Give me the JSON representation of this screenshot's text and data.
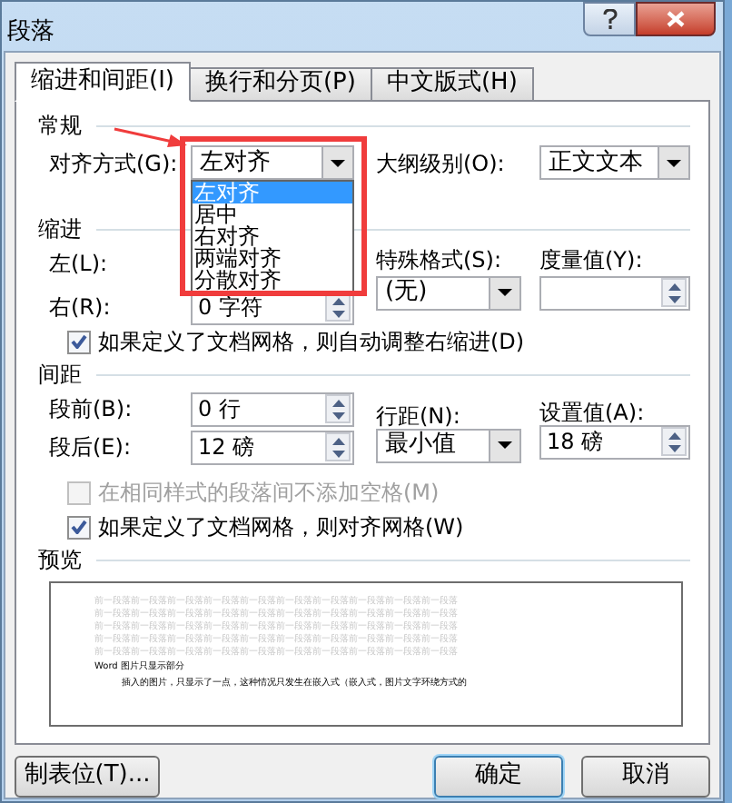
{
  "window": {
    "title": "段落"
  },
  "tabs": [
    {
      "label": "缩进和间距(I)",
      "selected": true
    },
    {
      "label": "换行和分页(P)",
      "selected": false
    },
    {
      "label": "中文版式(H)",
      "selected": false
    }
  ],
  "general": {
    "heading": "常规",
    "alignment": {
      "label": "对齐方式(G):",
      "value": "左对齐",
      "options": [
        {
          "label": "左对齐",
          "selected": true
        },
        {
          "label": "居中",
          "selected": false
        },
        {
          "label": "右对齐",
          "selected": false
        },
        {
          "label": "两端对齐",
          "selected": false
        },
        {
          "label": "分散对齐",
          "selected": false
        }
      ]
    },
    "outline_level": {
      "label": "大纲级别(O):",
      "value": "正文文本"
    }
  },
  "indent": {
    "heading": "缩进",
    "left": {
      "label": "左(L):"
    },
    "right": {
      "label": "右(R):",
      "value": "0 字符"
    },
    "special": {
      "label": "特殊格式(S):",
      "value": "(无)"
    },
    "measure": {
      "label": "度量值(Y):"
    }
  },
  "checkbox_auto": {
    "label": "如果定义了文档网格，则自动调整右缩进(D)",
    "checked": true,
    "disabled": false
  },
  "spacing": {
    "heading": "间距",
    "before": {
      "label": "段前(B):",
      "value": "0 行"
    },
    "after": {
      "label": "段后(E):",
      "value": "12 磅"
    },
    "line_spacing": {
      "label": "行距(N):",
      "value": "最小值"
    },
    "setting": {
      "label": "设置值(A):",
      "value": "18 磅"
    }
  },
  "checkboxes": [
    {
      "label": "在相同样式的段落间不添加空格(M)",
      "checked": false,
      "disabled": true
    },
    {
      "label": "如果定义了文档网格，则对齐网格(W)",
      "checked": true,
      "disabled": false
    }
  ],
  "preview": {
    "heading": "预览",
    "filler_lines": [
      "前一段落前一段落前一段落前一段落前一段落前一段落前一段落前一段落前一段落前一段落",
      "前一段落前一段落前一段落前一段落前一段落前一段落前一段落前一段落前一段落前一段落",
      "前一段落前一段落前一段落前一段落前一段落前一段落前一段落前一段落前一段落前一段落",
      "前一段落前一段落前一段落前一段落前一段落前一段落前一段落前一段落前一段落前一段落",
      "前一段落前一段落前一段落前一段落前一段落前一段落前一段落前一段落前一段落前一段落"
    ],
    "lines": [
      "Word 图片只显示部分",
      "插入的图片，只显示了一点，这种情况只发生在嵌入式（嵌入式，图片文字环绕方式的"
    ]
  },
  "buttons": [
    {
      "label": "制表位(T)...",
      "kind": "left",
      "default": false
    },
    {
      "label": "确定",
      "kind": "right",
      "default": true
    },
    {
      "label": "取消",
      "kind": "right",
      "default": false
    }
  ]
}
